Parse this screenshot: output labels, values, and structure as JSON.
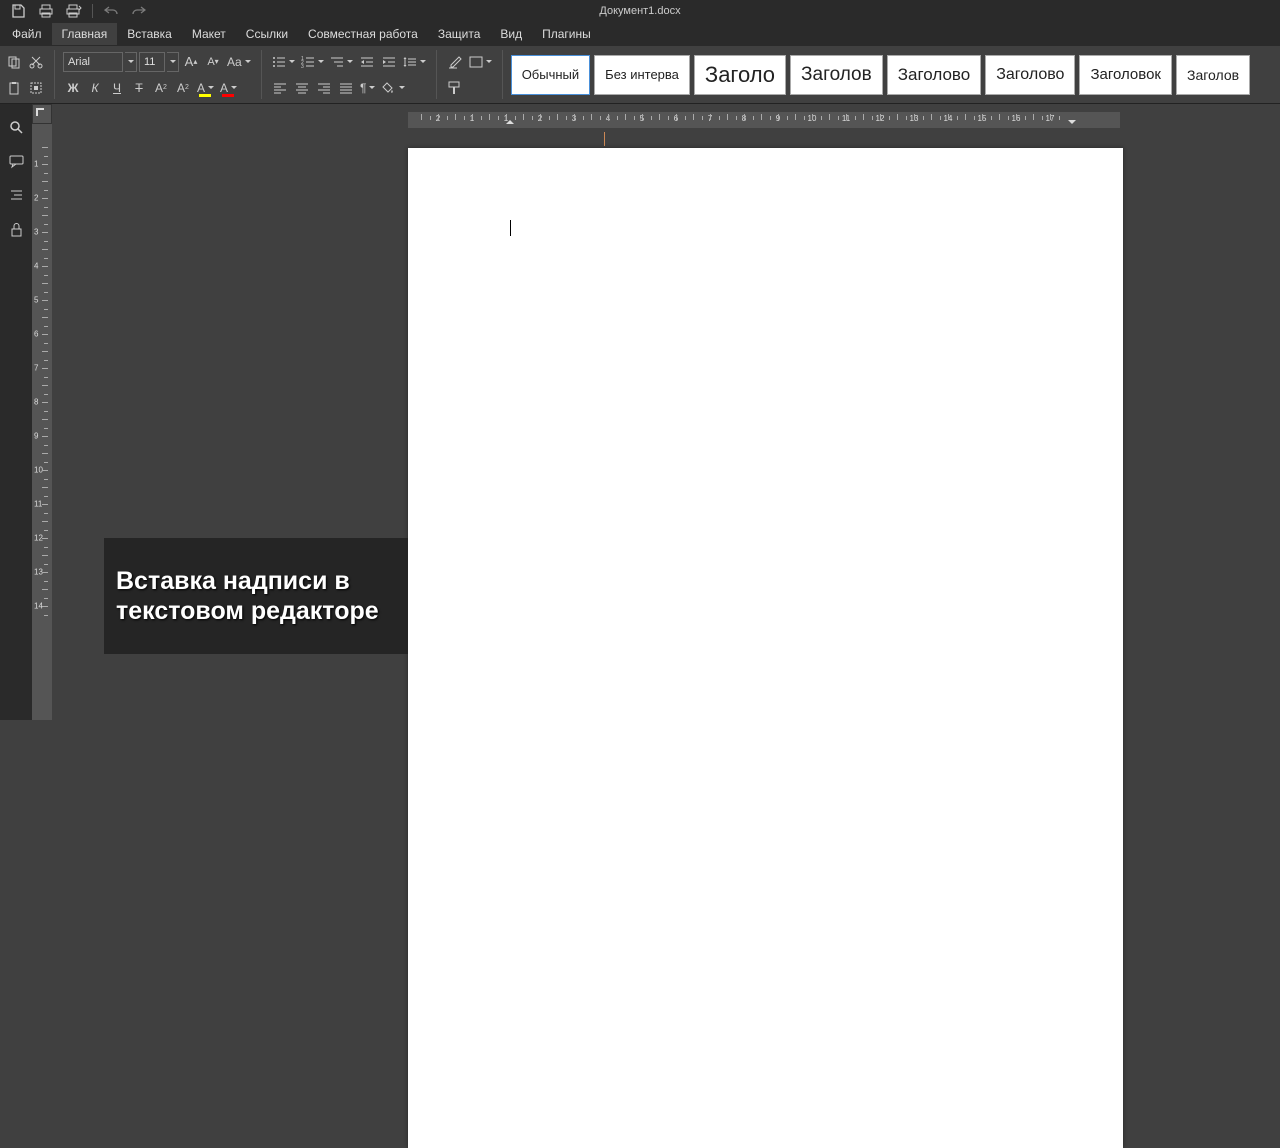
{
  "doc_title": "Документ1.docx",
  "menu": {
    "file": "Файл",
    "home": "Главная",
    "insert": "Вставка",
    "layout": "Макет",
    "references": "Ссылки",
    "collab": "Совместная работа",
    "protect": "Защита",
    "view": "Вид",
    "plugins": "Плагины"
  },
  "font": {
    "name": "Arial",
    "size": "11"
  },
  "format_buttons": {
    "bold": "Ж",
    "italic": "К",
    "underline": "Ч",
    "strike": "Т",
    "super": "X",
    "sub": "X",
    "incsize": "A",
    "decsize": "A",
    "case": "Aa",
    "highlight": "A",
    "fontcolor": "A"
  },
  "styles": [
    "Обычный",
    "Без интерва",
    "Заголо",
    "Заголов",
    "Заголово",
    "Заголово",
    "Заголовок",
    "Заголов"
  ],
  "h_ruler_nums": [
    "2",
    "1",
    "1",
    "2",
    "3",
    "4",
    "5",
    "6",
    "7",
    "8",
    "9",
    "10",
    "11",
    "12",
    "13",
    "14",
    "15",
    "16",
    "17"
  ],
  "v_ruler_nums": [
    "1",
    "2",
    "3",
    "4",
    "5",
    "6",
    "7",
    "8",
    "9",
    "10",
    "11",
    "12",
    "13",
    "14"
  ],
  "overlay_text": "Вставка надписи в текстовом редакторе"
}
